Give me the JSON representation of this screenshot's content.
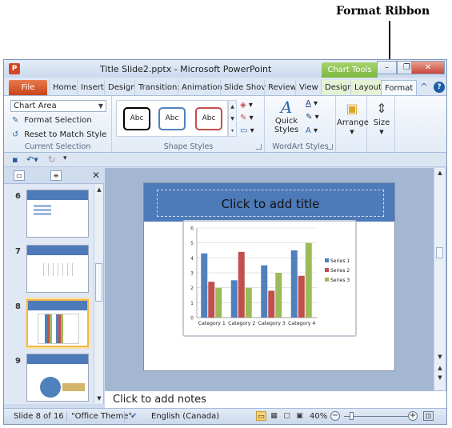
{
  "annotation": {
    "label": "Format Ribbon"
  },
  "window": {
    "app_icon": "P",
    "title": "Title Slide2.pptx - Microsoft PowerPoint",
    "context_tab_group": "Chart Tools",
    "controls": {
      "minimize": "–",
      "restore": "❐",
      "close": "✕"
    }
  },
  "tabs": [
    "File",
    "Home",
    "Insert",
    "Design",
    "Transition:",
    "Animation",
    "Slide Shov",
    "Review",
    "View",
    "Design",
    "Layout",
    "Format"
  ],
  "active_tab": "Format",
  "ribbon": {
    "current_selection": {
      "dropdown_value": "Chart Area",
      "format_selection": "Format Selection",
      "reset_to_match_style": "Reset to Match Style",
      "label": "Current Selection"
    },
    "shape_styles": {
      "samples": [
        {
          "text": "Abc",
          "color": "#000000"
        },
        {
          "text": "Abc",
          "color": "#4f81bd"
        },
        {
          "text": "Abc",
          "color": "#c0504d"
        }
      ],
      "label": "Shape Styles"
    },
    "wordart_styles": {
      "quick_styles": "Quick Styles",
      "label": "WordArt Styles"
    },
    "arrange": {
      "label": "Arrange"
    },
    "size": {
      "label": "Size"
    }
  },
  "qat": {
    "save_icon": "save-icon",
    "undo_icon": "undo-icon",
    "redo_icon": "redo-icon"
  },
  "slides_panel": {
    "slides": [
      {
        "number": "6"
      },
      {
        "number": "7"
      },
      {
        "number": "8",
        "selected": true
      },
      {
        "number": "9"
      }
    ]
  },
  "slide": {
    "title_placeholder": "Click to add title",
    "chart": {
      "y_ticks": [
        "0",
        "1",
        "2",
        "3",
        "4",
        "5",
        "6"
      ],
      "categories": [
        "Category 1",
        "Category 2",
        "Category 3",
        "Category 4"
      ],
      "series": [
        {
          "name": "Series 1",
          "color": "#4f81bd"
        },
        {
          "name": "Series 2",
          "color": "#c0504d"
        },
        {
          "name": "Series 3",
          "color": "#9bbb59"
        }
      ]
    }
  },
  "chart_data": {
    "type": "bar",
    "categories": [
      "Category 1",
      "Category 2",
      "Category 3",
      "Category 4"
    ],
    "series": [
      {
        "name": "Series 1",
        "values": [
          4.3,
          2.5,
          3.5,
          4.5
        ]
      },
      {
        "name": "Series 2",
        "values": [
          2.4,
          4.4,
          1.8,
          2.8
        ]
      },
      {
        "name": "Series 3",
        "values": [
          2,
          2,
          3,
          5
        ]
      }
    ],
    "ylim": [
      0,
      6
    ],
    "legend": "right",
    "grid": true
  },
  "notes": {
    "placeholder": "Click to add notes"
  },
  "status_bar": {
    "slide_info": "Slide 8 of 16",
    "theme": "\"Office Theme\"",
    "language": "English (Canada)",
    "zoom": "40%"
  }
}
